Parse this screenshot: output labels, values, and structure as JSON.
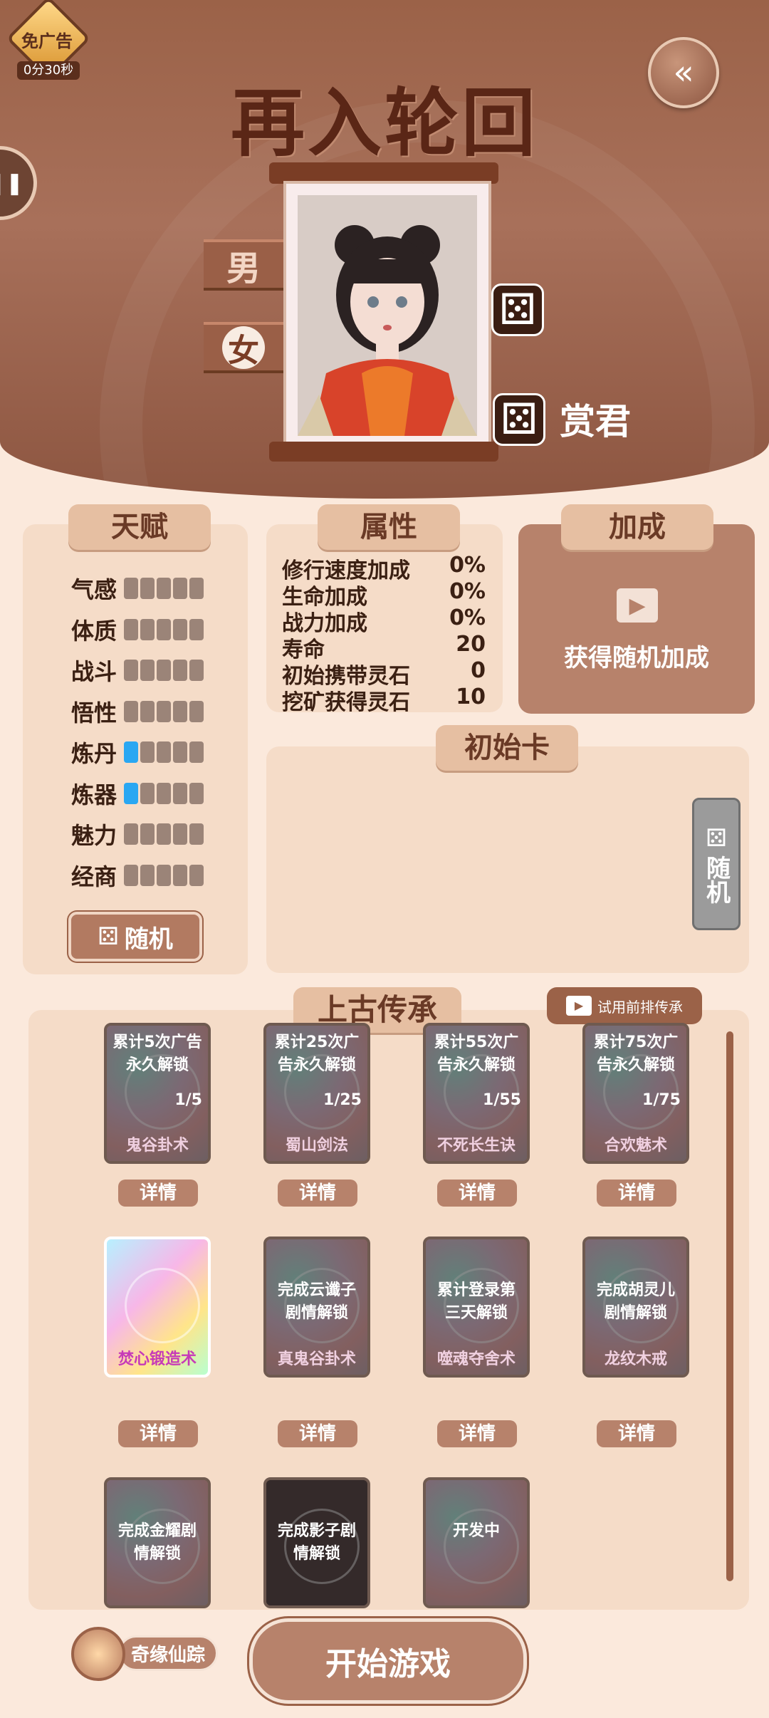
{
  "ad_badge": {
    "label": "免广告",
    "timer": "0分30秒"
  },
  "title": "再入轮回",
  "gender": {
    "male": "男",
    "female": "女"
  },
  "character": {
    "name": "赏君"
  },
  "talent": {
    "tab": "天赋",
    "random_label": "随机",
    "items": [
      {
        "label": "气感",
        "level": 0
      },
      {
        "label": "体质",
        "level": 0
      },
      {
        "label": "战斗",
        "level": 0
      },
      {
        "label": "悟性",
        "level": 0
      },
      {
        "label": "炼丹",
        "level": 1
      },
      {
        "label": "炼器",
        "level": 1
      },
      {
        "label": "魅力",
        "level": 0
      },
      {
        "label": "经商",
        "level": 0
      }
    ]
  },
  "attributes": {
    "tab": "属性",
    "rows": [
      {
        "label": "修行速度加成",
        "value": "0%"
      },
      {
        "label": "生命加成",
        "value": "0%"
      },
      {
        "label": "战力加成",
        "value": "0%"
      },
      {
        "label": "寿命",
        "value": "20"
      },
      {
        "label": "初始携带灵石",
        "value": "0"
      },
      {
        "label": "挖矿获得灵石",
        "value": "10"
      }
    ]
  },
  "bonus": {
    "tab": "加成",
    "text": "获得随机加成"
  },
  "initial_card": {
    "tab": "初始卡",
    "random_label": "随机"
  },
  "legacy": {
    "tab": "上古传承",
    "trial_label": "试用前排传承",
    "detail_label": "详情",
    "cards": [
      {
        "lock": "累计5次广告永久解锁",
        "progress": "1/5",
        "name": "鬼谷卦术"
      },
      {
        "lock": "累计25次广告永久解锁",
        "progress": "1/25",
        "name": "蜀山剑法"
      },
      {
        "lock": "累计55次广告永久解锁",
        "progress": "1/55",
        "name": "不死长生诀"
      },
      {
        "lock": "累计75次广告永久解锁",
        "progress": "1/75",
        "name": "合欢魅术"
      },
      {
        "lock": "",
        "progress": "",
        "name": "焚心锻造术"
      },
      {
        "lock": "完成云谶子剧情解锁",
        "progress": "",
        "name": "真鬼谷卦术"
      },
      {
        "lock": "累计登录第三天解锁",
        "progress": "",
        "name": "噬魂夺舍术"
      },
      {
        "lock": "完成胡灵儿剧情解锁",
        "progress": "",
        "name": "龙纹木戒"
      },
      {
        "lock": "完成金耀剧情解锁",
        "progress": "",
        "name": ""
      },
      {
        "lock": "完成影子剧情解锁",
        "progress": "",
        "name": ""
      },
      {
        "lock": "开发中",
        "progress": "",
        "name": ""
      }
    ]
  },
  "qiyuan_label": "奇缘仙踪",
  "start_label": "开始游戏"
}
